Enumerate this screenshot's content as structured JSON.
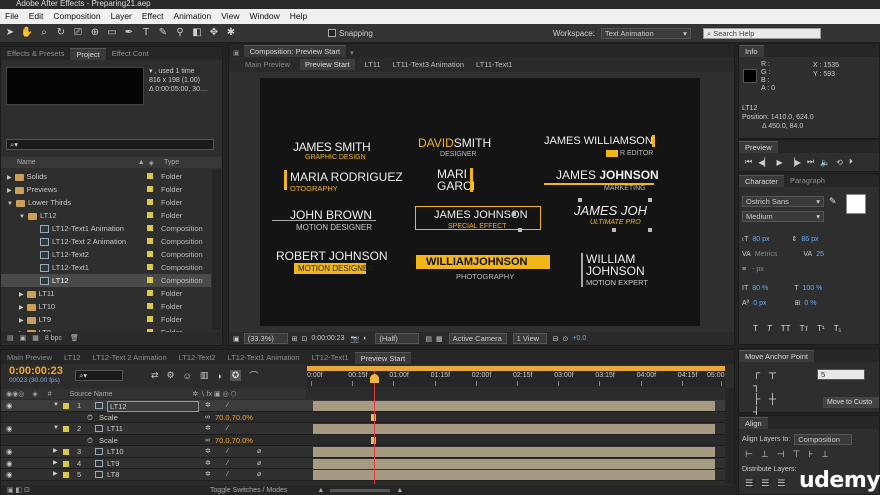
{
  "window": {
    "title": "Adobe After Effects - Preparing21.aep"
  },
  "menu": [
    "File",
    "Edit",
    "Composition",
    "Layer",
    "Effect",
    "Animation",
    "View",
    "Window",
    "Help"
  ],
  "toolbar": {
    "snapping_label": "Snapping",
    "workspace_label": "Workspace:",
    "workspace_value": "Text Animation",
    "search_placeholder": "Search Help"
  },
  "project_panel": {
    "tabs": [
      "Effects & Presets",
      "Project",
      "Effect Cont"
    ],
    "info_lines": [
      ", used 1 time",
      "816 x 198 (1.00)",
      "Δ 0:00:05:00, 30...."
    ],
    "columns": {
      "name": "Name",
      "type": "Type"
    },
    "items": [
      {
        "name": "Solids",
        "type": "Folder",
        "kind": "folder",
        "indent": 0
      },
      {
        "name": "Previews",
        "type": "Folder",
        "kind": "folder",
        "indent": 0
      },
      {
        "name": "Lower Thirds",
        "type": "Folder",
        "kind": "folder",
        "indent": 0
      },
      {
        "name": "LT12",
        "type": "Folder",
        "kind": "folder",
        "indent": 1
      },
      {
        "name": "LT12-Text1 Animation",
        "type": "Composition",
        "kind": "comp",
        "indent": 2
      },
      {
        "name": "LT12-Text 2 Animation",
        "type": "Composition",
        "kind": "comp",
        "indent": 2
      },
      {
        "name": "LT12-Text2",
        "type": "Composition",
        "kind": "comp",
        "indent": 2
      },
      {
        "name": "LT12-Text1",
        "type": "Composition",
        "kind": "comp",
        "indent": 2
      },
      {
        "name": "LT12",
        "type": "Composition",
        "kind": "comp",
        "indent": 2,
        "selected": true
      },
      {
        "name": "LT11",
        "type": "Folder",
        "kind": "folder",
        "indent": 1
      },
      {
        "name": "LT10",
        "type": "Folder",
        "kind": "folder",
        "indent": 1
      },
      {
        "name": "LT9",
        "type": "Folder",
        "kind": "folder",
        "indent": 1
      },
      {
        "name": "LT8",
        "type": "Folder",
        "kind": "folder",
        "indent": 1
      }
    ],
    "bpc": "8 bpc"
  },
  "composition_panel": {
    "tab": "Composition: Preview Start",
    "nav": [
      "Main Preview",
      "Preview Start",
      "LT11",
      "LT11-Text3 Animation",
      "LT11-Text1"
    ],
    "footer": {
      "zoom": "(33.3%)",
      "timecode": "0:00:00:23",
      "resolution": "(Half)",
      "camera": "Active Camera",
      "view": "1 View",
      "exposure": "+0.0"
    },
    "lower_thirds": {
      "a1": "JAMES SMITH",
      "a2": "GRAPHIC DESIGN",
      "b1a": "DAVID",
      "b1b": "SMITH",
      "b2": "DESIGNER",
      "c1": "JAMES WILLIAMSON",
      "c2": "R EDITOR",
      "d1": "MARIA RODRIGUEZ",
      "d2": "OTOGRAPHY",
      "e1": "MARI",
      "e2": "GARCI",
      "f1a": "JAMES",
      "f1b": "JOHNSON",
      "f2": "MARKETING",
      "g1": "JOHN BROWN",
      "g2": "MOTION DESIGNER",
      "h1": "JAMES JOHNSON",
      "h2": "SPECIAL EFFECT",
      "i1": "JAMES JOH",
      "i2": "ULTIMATE PRO",
      "j1": "ROBERT JOHNSON",
      "j2": "MOTION DESIGNER",
      "k1": "WILLIAMJOHNSON",
      "k2": "PHOTOGRAPHY",
      "l1": "WILLIAM",
      "l2": "JOHNSON",
      "l3": "MOTION EXPERT"
    }
  },
  "info_panel": {
    "tab": "Info",
    "r": "R :",
    "g": "G :",
    "b": "B :",
    "a": "A : 0",
    "x": "X : 1535",
    "y": "Y : 593",
    "layer": "LT12",
    "position": "Position: 1410.0, 624.0",
    "delta": "Δ 450.0, 84.0"
  },
  "preview_panel": {
    "tab": "Preview"
  },
  "character_panel": {
    "tabs": [
      "Character",
      "Paragraph"
    ],
    "font": "Ostrich Sans",
    "style": "Medium",
    "size": "80 px",
    "leading": "86 px",
    "metrics": "Metrics",
    "tracking": "25",
    "stroke": "- px",
    "vscale": "80 %",
    "hscale": "100 %",
    "baseline": "0 px",
    "tsume": "0 %",
    "styles": [
      "T",
      "T",
      "TT",
      "Tт",
      "T¹",
      "T₁"
    ]
  },
  "anchor_panel": {
    "tab": "Move Anchor Point",
    "value": "5",
    "button": "Move to Custo"
  },
  "align_panel": {
    "tab": "Align",
    "align_to_label": "Align Layers to:",
    "align_to_value": "Composition",
    "distribute_label": "Distribute Layers:"
  },
  "timeline": {
    "tabs": [
      "Main Preview",
      "LT12",
      "LT12-Text 2 Animation",
      "LT12-Text2",
      "LT12-Text1 Animation",
      "LT12-Text1",
      "Preview Start"
    ],
    "timecode": "0:00:00:23",
    "fps": "00023 (30.00 fps)",
    "header": {
      "num": "#",
      "source": "Source Name"
    },
    "ruler": [
      "0:00f",
      "00:15f",
      "01:00f",
      "01:15f",
      "02:00f",
      "02:15f",
      "03:00f",
      "03:15f",
      "04:00f",
      "04:15f",
      "05:00"
    ],
    "layers": [
      {
        "num": "1",
        "name": "LT12",
        "sub": false,
        "selected": true
      },
      {
        "num": "",
        "name": "Scale",
        "sub": true,
        "value": "70.0,70.0%"
      },
      {
        "num": "2",
        "name": "LT11",
        "sub": false
      },
      {
        "num": "",
        "name": "Scale",
        "sub": true,
        "value": "70.0,70.0%"
      },
      {
        "num": "3",
        "name": "LT10",
        "sub": false
      },
      {
        "num": "4",
        "name": "LT9",
        "sub": false
      },
      {
        "num": "5",
        "name": "LT8",
        "sub": false
      }
    ],
    "footer": "Toggle Switches / Modes"
  },
  "watermark": "udemy",
  "colors": {
    "accent_gold": "#f2b619",
    "timecode_orange": "#f0a830",
    "playhead": "#e23b3b",
    "bar": "#a69a82"
  }
}
